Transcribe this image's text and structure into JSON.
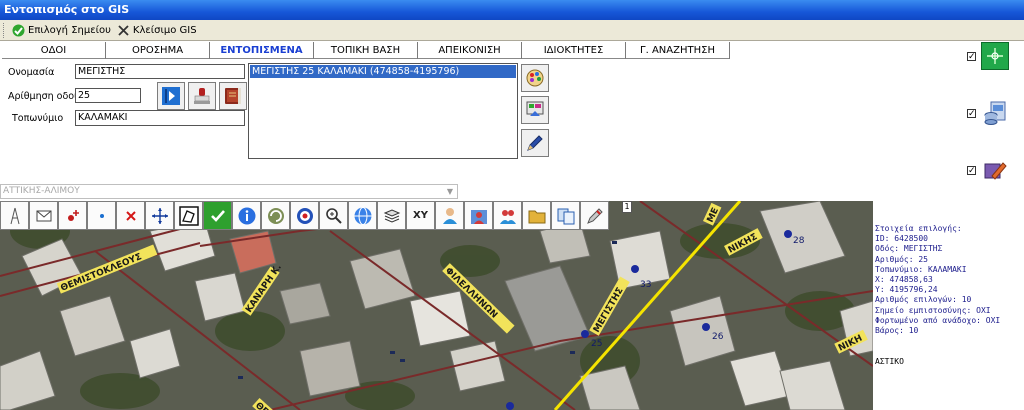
{
  "window": {
    "title": "Εντοπισμός στο GIS"
  },
  "toolbar": {
    "select_point_label": "Επιλογή Σημείου",
    "close_gis_label": "Κλείσιμο GIS"
  },
  "tabs": [
    {
      "label": "ΟΔΟΙ"
    },
    {
      "label": "ΟΡΟΣΗΜΑ"
    },
    {
      "label": "ΕΝΤΟΠΙΣΜΕΝΑ"
    },
    {
      "label": "ΤΟΠΙΚΗ ΒΑΣΗ"
    },
    {
      "label": "ΑΠΕΙΚΟΝΙΣΗ"
    },
    {
      "label": "ΙΔΙΟΚΤΗΤΕΣ"
    },
    {
      "label": "Γ. ΑΝΑΖΗΤΗΣΗ"
    }
  ],
  "active_tab": "ΕΝΤΟΠΙΣΜΕΝΑ",
  "form": {
    "name_label": "Ονομασία",
    "name_value": "ΜΕΓΙΣΤΗΣ",
    "number_label": "Αρίθμηση οδού",
    "number_value": "25",
    "place_label": "Τοπωνύμιο",
    "place_value": "ΚΑΛΑΜΑΚΙ"
  },
  "results_list": [
    "ΜΕΓΙΣΤΗΣ 25 ΚΑΛΑΜΑΚΙ (474858-4195796)"
  ],
  "right_checks": [
    true,
    true,
    true
  ],
  "municipality_combo": "ΑΤΤΙΚΗΣ-ΑΛΙΜΟΥ",
  "map": {
    "toolbar_items": [
      {
        "icon": "compass-icon"
      },
      {
        "icon": "envelope-icon"
      },
      {
        "icon": "add-point-icon"
      },
      {
        "icon": "point-icon"
      },
      {
        "icon": "delete-icon"
      },
      {
        "icon": "pan-icon"
      },
      {
        "icon": "polygon-select-icon"
      },
      {
        "icon": "check-icon"
      },
      {
        "icon": "info-icon"
      },
      {
        "icon": "refresh-icon"
      },
      {
        "icon": "target-icon"
      },
      {
        "icon": "zoom-icon"
      },
      {
        "icon": "globe-icon"
      },
      {
        "icon": "layers-icon"
      },
      {
        "icon": "xy-text",
        "text": "XY"
      },
      {
        "icon": "user-icon"
      },
      {
        "icon": "map-user-icon"
      },
      {
        "icon": "users-icon"
      },
      {
        "icon": "folder-icon"
      },
      {
        "icon": "copy-icon"
      },
      {
        "icon": "pen-icon"
      }
    ],
    "count": "1",
    "streets": [
      "ΘΕΜΙΣΤΟΚΛΕΟΥΣ",
      "ΚΑΝΑΡΗ Κ.",
      "ΦΙΛΕΛΛΗΝΩΝ",
      "ΜΕΓΙΣΤΗΣ",
      "ΝΙΚΗΣ",
      "ΘΕΜ",
      "ΝΙΚΗ",
      "ΜΕ"
    ],
    "numbers": [
      "28",
      "33",
      "25",
      "26"
    ]
  },
  "selection_info": {
    "lines": [
      "Στοιχεία επιλογής:",
      "ID: 6428500",
      "Οδός: ΜΕΓΙΣΤΗΣ",
      "Αριθμός: 25",
      "Τοπωνύμιο: ΚΑΛΑΜΑΚΙ",
      "X: 474858,63",
      "Y: 4195796,24",
      "Αριθμός επιλογών: 10",
      "Σημείο εμπιστοσύνης: ΟΧΙ",
      "Φορτωμένο από ανάδοχο: ΟΧΙ",
      "Βάρος: 10"
    ],
    "zone": "ΑΣΤΙΚΟ"
  },
  "colors": {
    "title_bar": "#1657d8",
    "active_tab": "#1a3fd2",
    "list_selection": "#3169c6",
    "info_text": "#1c1c8c",
    "street_highlight": "#f5e400"
  }
}
